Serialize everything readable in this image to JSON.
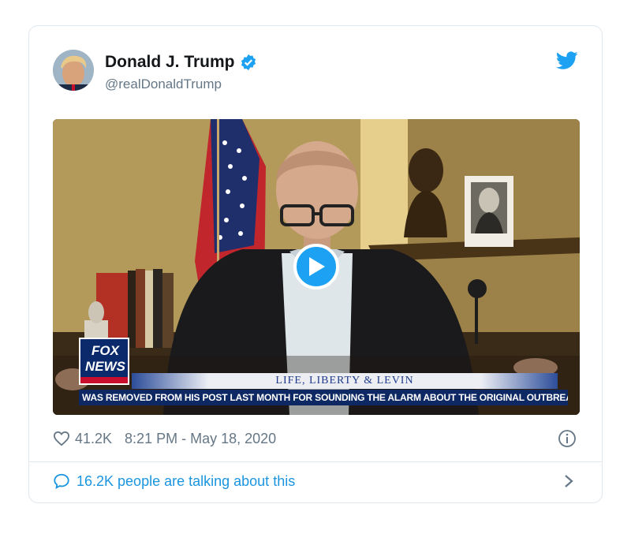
{
  "tweet": {
    "author_name": "Donald J. Trump",
    "author_handle": "@realDonaldTrump",
    "likes": "41.2K",
    "timestamp": "8:21 PM - May 18, 2020",
    "talking_label": "16.2K people are talking about this"
  },
  "video": {
    "logo_line1": "FOX",
    "logo_line2": "NEWS",
    "show_title": "LIFE, LIBERTY & LEVIN",
    "chyron": "WAS REMOVED FROM HIS POST LAST MONTH FOR SOUNDING THE ALARM ABOUT THE ORIGINAL OUTBREA"
  },
  "icons": {
    "verified": "verified-badge-icon",
    "brand": "twitter-bird-icon",
    "play": "play-icon",
    "like": "heart-icon",
    "info": "info-icon",
    "reply": "speech-bubble-icon",
    "more": "chevron-right-icon"
  },
  "colors": {
    "accent": "#1da1f2",
    "link": "#1b95e0",
    "muted": "#657786",
    "border": "#e1e8ed"
  }
}
